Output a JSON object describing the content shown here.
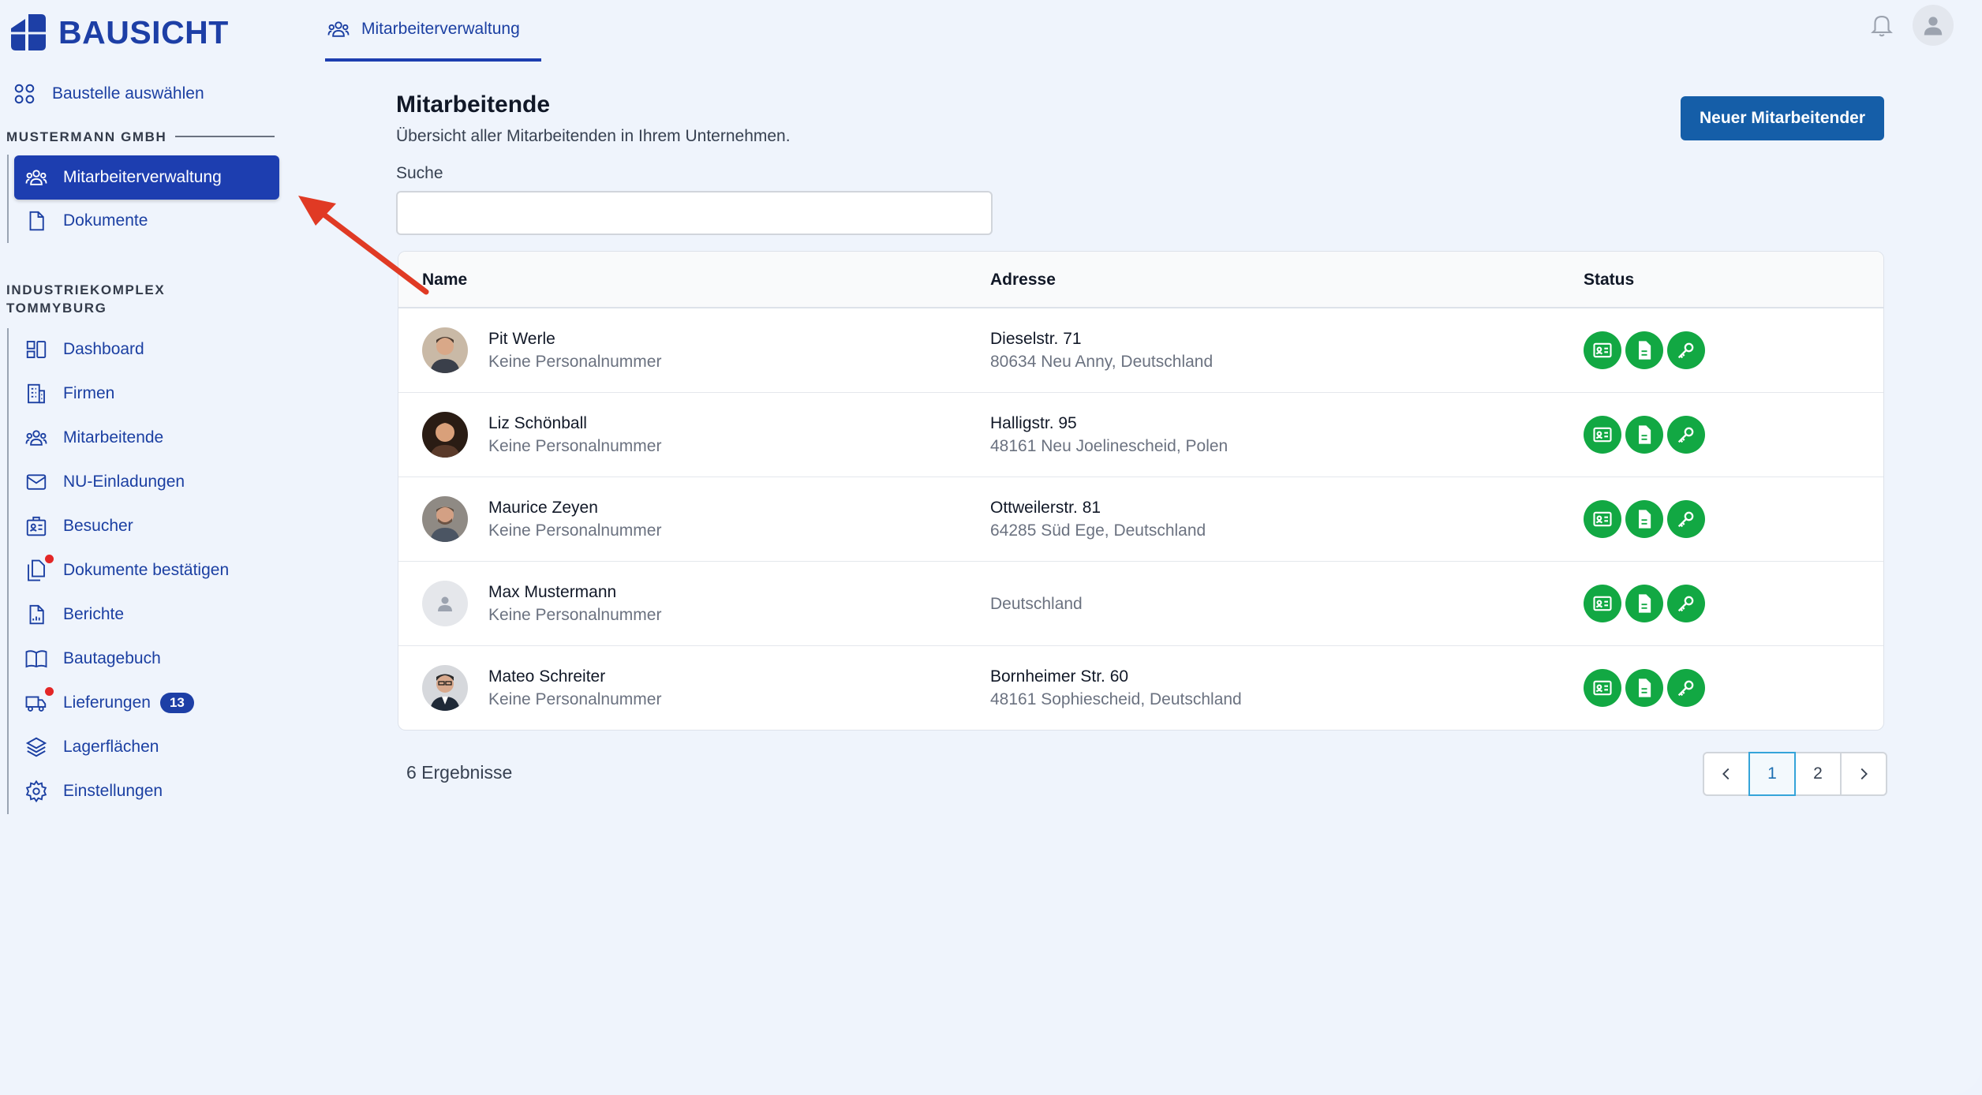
{
  "app": {
    "logo_text": "BAUSICHT",
    "brand_color": "#1d3fa6",
    "accent_color": "#1d3eb0",
    "status_color": "#12a843",
    "primary_button_color": "#155ea8"
  },
  "sidebar": {
    "site_select": {
      "label": "Baustelle auswählen",
      "icon": "grid-icon"
    },
    "company": {
      "label": "MUSTERMANN GMBH",
      "items": [
        {
          "label": "Mitarbeiterverwaltung",
          "icon": "users-icon",
          "active": true
        },
        {
          "label": "Dokumente",
          "icon": "document-icon"
        }
      ]
    },
    "project": {
      "label_line1": "INDUSTRIEKOMPLEX",
      "label_line2": "TOMMYBURG",
      "items": [
        {
          "label": "Dashboard",
          "icon": "dashboard-icon"
        },
        {
          "label": "Firmen",
          "icon": "building-icon"
        },
        {
          "label": "Mitarbeitende",
          "icon": "users-icon"
        },
        {
          "label": "NU-Einladungen",
          "icon": "mail-icon"
        },
        {
          "label": "Besucher",
          "icon": "badge-icon"
        },
        {
          "label": "Dokumente bestätigen",
          "icon": "documents-icon",
          "notification_dot": true
        },
        {
          "label": "Berichte",
          "icon": "report-icon"
        },
        {
          "label": "Bautagebuch",
          "icon": "book-icon"
        },
        {
          "label": "Lieferungen",
          "icon": "truck-icon",
          "notification_dot": true,
          "badge": "13"
        },
        {
          "label": "Lagerflächen",
          "icon": "layers-icon"
        },
        {
          "label": "Einstellungen",
          "icon": "settings-icon"
        }
      ]
    }
  },
  "topbar": {
    "tab_label": "Mitarbeiterverwaltung",
    "tab_icon": "users-icon",
    "notification_icon": "bell-icon",
    "user_icon": "user-avatar-icon"
  },
  "main": {
    "title": "Mitarbeitende",
    "subtitle": "Übersicht aller Mitarbeitenden in Ihrem Unternehmen.",
    "new_button": "Neuer Mitarbeitender",
    "search": {
      "label": "Suche",
      "value": "",
      "placeholder": ""
    },
    "table": {
      "columns": [
        "Name",
        "Adresse",
        "Status"
      ],
      "rows": [
        {
          "name": "Pit Werle",
          "personnel": "Keine Personalnummer",
          "address1": "Dieselstr. 71",
          "address2": "80634 Neu Anny, Deutschland",
          "status": [
            "id-card-icon",
            "file-icon",
            "key-icon"
          ]
        },
        {
          "name": "Liz Schönball",
          "personnel": "Keine Personalnummer",
          "address1": "Halligstr. 95",
          "address2": "48161 Neu Joelinescheid, Polen",
          "status": [
            "id-card-icon",
            "file-icon",
            "key-icon"
          ]
        },
        {
          "name": "Maurice Zeyen",
          "personnel": "Keine Personalnummer",
          "address1": "Ottweilerstr. 81",
          "address2": "64285 Süd Ege, Deutschland",
          "status": [
            "id-card-icon",
            "file-icon",
            "key-icon"
          ]
        },
        {
          "name": "Max Mustermann",
          "personnel": "Keine Personalnummer",
          "address1": "",
          "address2": "Deutschland",
          "status": [
            "id-card-icon",
            "file-icon",
            "key-icon"
          ]
        },
        {
          "name": "Mateo Schreiter",
          "personnel": "Keine Personalnummer",
          "address1": "Bornheimer Str. 60",
          "address2": "48161 Sophiescheid, Deutschland",
          "status": [
            "id-card-icon",
            "file-icon",
            "key-icon"
          ]
        }
      ]
    },
    "results": "6 Ergebnisse",
    "pagination": {
      "prev_icon": "chevron-left-icon",
      "pages": [
        "1",
        "2"
      ],
      "current": "1",
      "next_icon": "chevron-right-icon"
    }
  }
}
